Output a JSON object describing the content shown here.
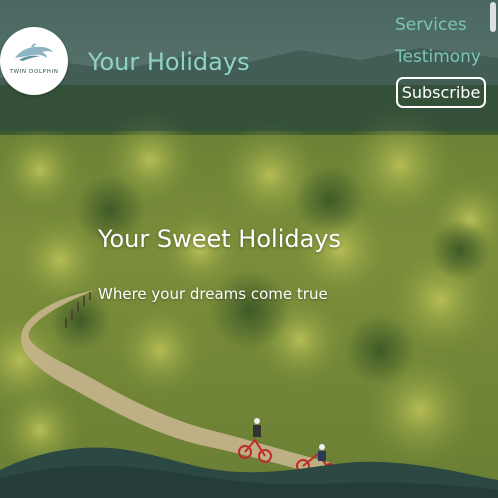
{
  "nav": {
    "logo_text": "TWIN DOLPHIN",
    "brand": "Your Holidays",
    "links": [
      "Services",
      "Testimony"
    ],
    "subscribe_label": "Subscribe"
  },
  "hero": {
    "title": "Your Sweet Holidays",
    "subtitle": "Where your dreams come true"
  },
  "colors": {
    "nav_overlay": "#2c4842",
    "brand_text": "#8fd3c5",
    "nav_link": "#7cc6b6",
    "wave": "#2c4842"
  },
  "icons": {
    "logo": "dolphin-icon"
  }
}
